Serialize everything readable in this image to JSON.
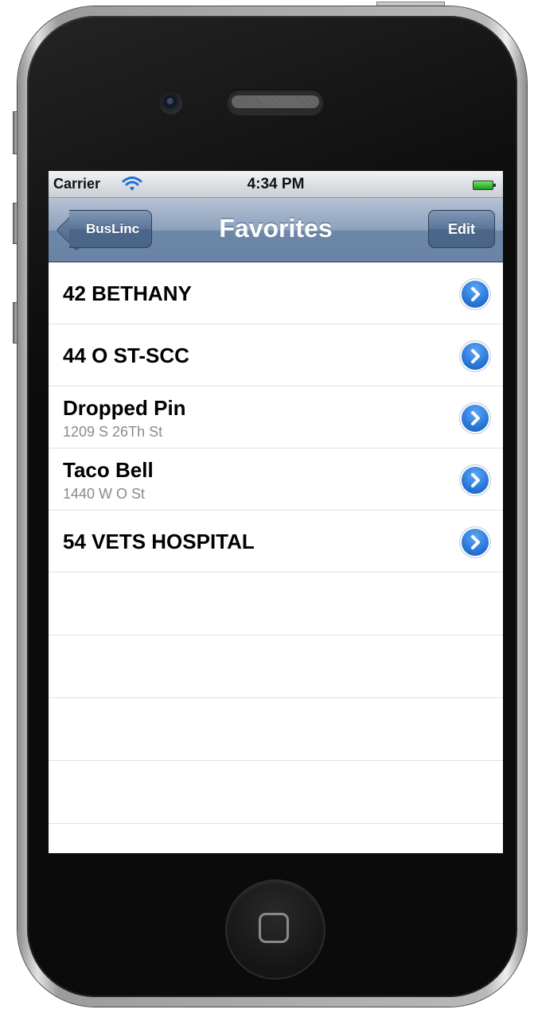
{
  "status_bar": {
    "carrier": "Carrier",
    "time": "4:34 PM"
  },
  "nav": {
    "back_label": "BusLinc",
    "title": "Favorites",
    "edit_label": "Edit"
  },
  "favorites": [
    {
      "title": "42 BETHANY",
      "subtitle": ""
    },
    {
      "title": "44 O ST-SCC",
      "subtitle": ""
    },
    {
      "title": "Dropped Pin",
      "subtitle": "1209 S 26Th St"
    },
    {
      "title": "Taco Bell",
      "subtitle": "1440 W O St"
    },
    {
      "title": "54 VETS HOSPITAL",
      "subtitle": ""
    }
  ],
  "icons": {
    "signal": "wifi-icon",
    "battery": "battery-icon",
    "row_action": "detail-disclosure-icon",
    "home": "home-button-icon"
  },
  "colors": {
    "nav_bar": "#6d87a8",
    "disclosure": "#2977d9",
    "subtitle": "#8a8a8a"
  }
}
